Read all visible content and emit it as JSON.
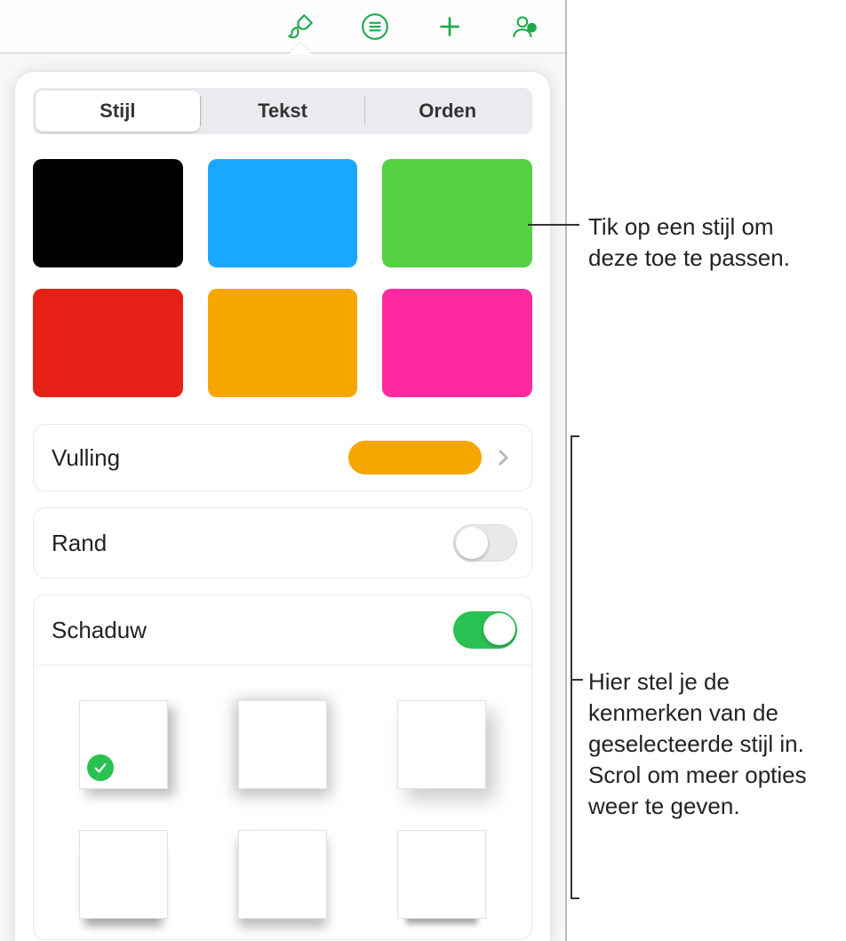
{
  "toolbar": {
    "icons": [
      "brush-icon",
      "list-circle-icon",
      "plus-icon",
      "collaborate-icon"
    ],
    "active_index": 0,
    "accent": "#1fa94a"
  },
  "segmented": {
    "items": [
      "Stijl",
      "Tekst",
      "Orden"
    ],
    "active_index": 0
  },
  "style_swatches": [
    {
      "color": "#000000"
    },
    {
      "color": "#1aa8ff"
    },
    {
      "color": "#55d043"
    },
    {
      "color": "#e52017"
    },
    {
      "color": "#f5a600"
    },
    {
      "color": "#ff2aa1"
    }
  ],
  "fill": {
    "label": "Vulling",
    "color": "#f5a600"
  },
  "border": {
    "label": "Rand",
    "on": false
  },
  "shadow": {
    "label": "Schaduw",
    "on": true,
    "options": [
      {
        "kind": "drop",
        "selected": true
      },
      {
        "kind": "centred",
        "selected": false
      },
      {
        "kind": "soft",
        "selected": false
      },
      {
        "kind": "contact",
        "selected": false
      },
      {
        "kind": "curl",
        "selected": false
      },
      {
        "kind": "flat",
        "selected": false
      }
    ]
  },
  "callouts": {
    "top": "Tik op een stijl om deze toe te passen.",
    "bottom": "Hier stel je de kenmerken van de geselecteerde stijl in. Scrol om meer opties weer te geven."
  }
}
